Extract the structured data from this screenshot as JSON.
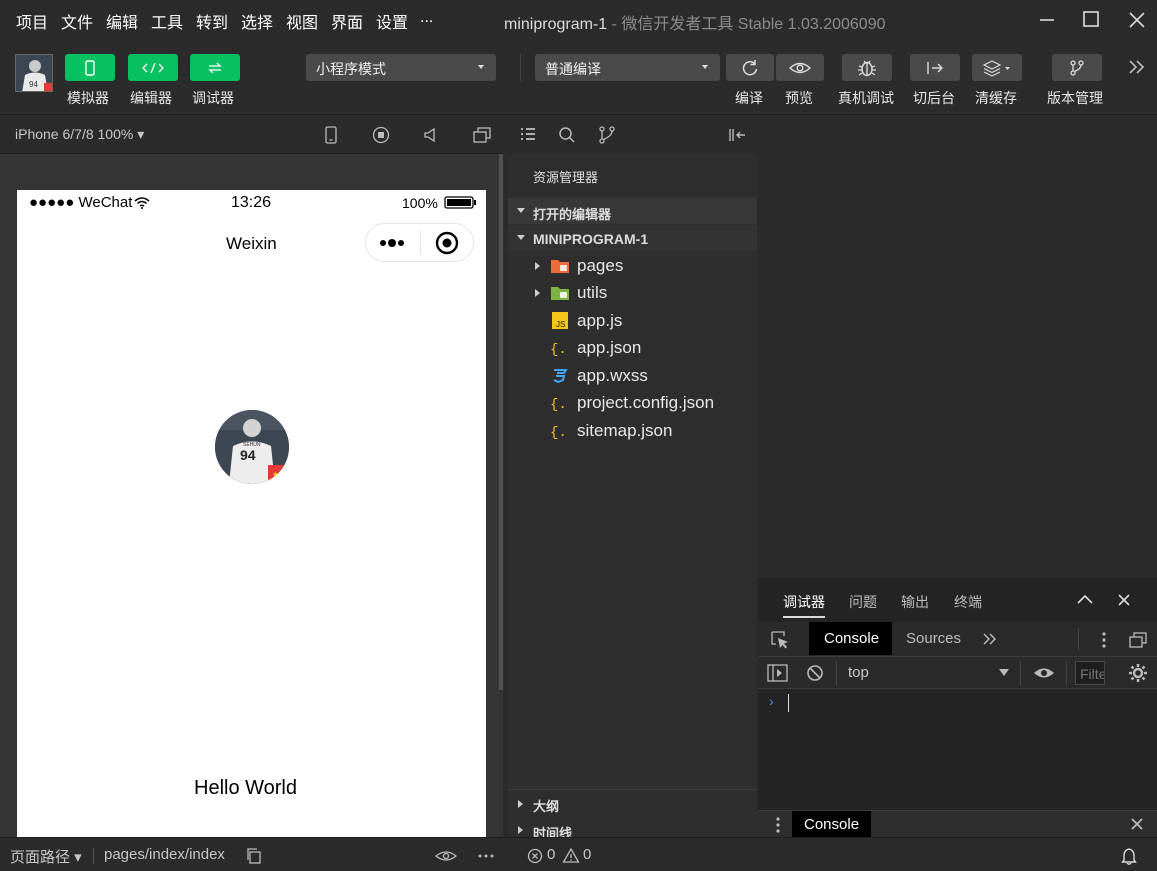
{
  "menu": [
    "项目",
    "文件",
    "编辑",
    "工具",
    "转到",
    "选择",
    "视图",
    "界面",
    "设置",
    "..."
  ],
  "window": {
    "title": "miniprogram-1",
    "subtitle": " - 微信开发者工具 Stable 1.03.2006090"
  },
  "toolbar": {
    "simulator": "模拟器",
    "editor": "编辑器",
    "debugger": "调试器",
    "mode_select": "小程序模式",
    "compile_select": "普通编译",
    "compile": "编译",
    "preview": "预览",
    "real_debug": "真机调试",
    "background": "切后台",
    "clear_cache": "清缓存",
    "version": "版本管理"
  },
  "simulator": {
    "device": "iPhone 6/7/8 100% ▾",
    "status_signal": "●●●●● WeChat",
    "status_time": "13:26",
    "status_battery": "100%",
    "nav_title": "Weixin",
    "hello": "Hello World"
  },
  "explorer": {
    "title": "资源管理器",
    "open_editors": "打开的编辑器",
    "project": "MINIPROGRAM-1",
    "files": [
      {
        "name": "pages",
        "type": "folder",
        "icon": "folder-orange-icon"
      },
      {
        "name": "utils",
        "type": "folder",
        "icon": "folder-green-icon"
      },
      {
        "name": "app.js",
        "type": "file",
        "icon": "js-icon"
      },
      {
        "name": "app.json",
        "type": "file",
        "icon": "json-icon"
      },
      {
        "name": "app.wxss",
        "type": "file",
        "icon": "css-icon"
      },
      {
        "name": "project.config.json",
        "type": "file",
        "icon": "json-icon"
      },
      {
        "name": "sitemap.json",
        "type": "file",
        "icon": "json-icon"
      }
    ],
    "outline": "大纲",
    "timeline": "时间线"
  },
  "debugger": {
    "tabs": [
      "调试器",
      "问题",
      "输出",
      "终端"
    ],
    "console_tab": "Console",
    "sources_tab": "Sources",
    "context": "top",
    "filter_placeholder": "Filter",
    "drawer_tab": "Console"
  },
  "status": {
    "page_path_label": "页面路径 ▾",
    "page_path": "pages/index/index",
    "errors": "0",
    "warnings": "0"
  },
  "colors": {
    "accent_green": "#07c160",
    "bg_dark": "#2b2b2b",
    "link_blue": "#4c8bf5"
  }
}
